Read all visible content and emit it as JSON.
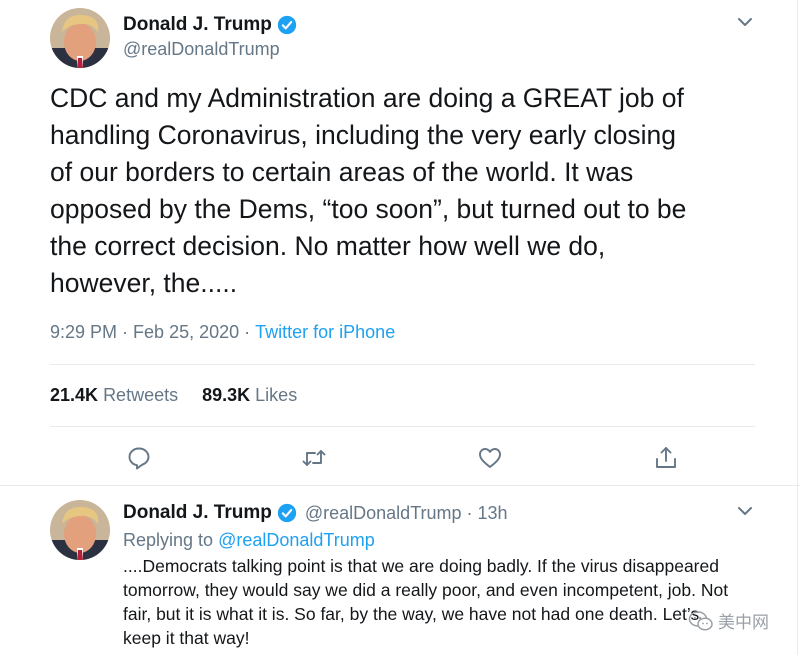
{
  "colors": {
    "text": "#14171a",
    "secondary": "#657786",
    "link": "#1da1f2",
    "border": "#e6ecf0"
  },
  "main_tweet": {
    "author": {
      "name": "Donald J. Trump",
      "handle": "@realDonaldTrump",
      "verified_icon": "verified-badge-icon"
    },
    "text": "CDC and my Administration are doing a GREAT job of\nhandling Coronavirus, including the very early closing\nof our borders to certain areas of the world. It was\nopposed by the Dems, “too soon”, but turned out to be\nthe correct decision. No matter how well we do,\nhowever, the.....",
    "time": "9:29 PM",
    "date": "Feb 25, 2020",
    "separator": "·",
    "source": "Twitter for iPhone",
    "retweets": {
      "count": "21.4K",
      "label": "Retweets"
    },
    "likes": {
      "count": "89.3K",
      "label": "Likes"
    },
    "actions": [
      "reply-icon",
      "retweet-icon",
      "like-icon",
      "share-icon"
    ]
  },
  "reply_tweet": {
    "author": {
      "name": "Donald J. Trump",
      "handle": "@realDonaldTrump",
      "age": "13h"
    },
    "separator": "·",
    "replying_to_label": "Replying to",
    "replying_to_handle": "@realDonaldTrump",
    "text": "....Democrats talking point is that we are doing badly. If the virus disappeared\ntomorrow, they would say we did a really poor, and even incompetent, job. Not\nfair, but it is what it is. So far, by the way, we have not had one death. Let’s\nkeep it that way!"
  },
  "watermark": {
    "text": "美中网",
    "icon": "wechat-icon"
  }
}
